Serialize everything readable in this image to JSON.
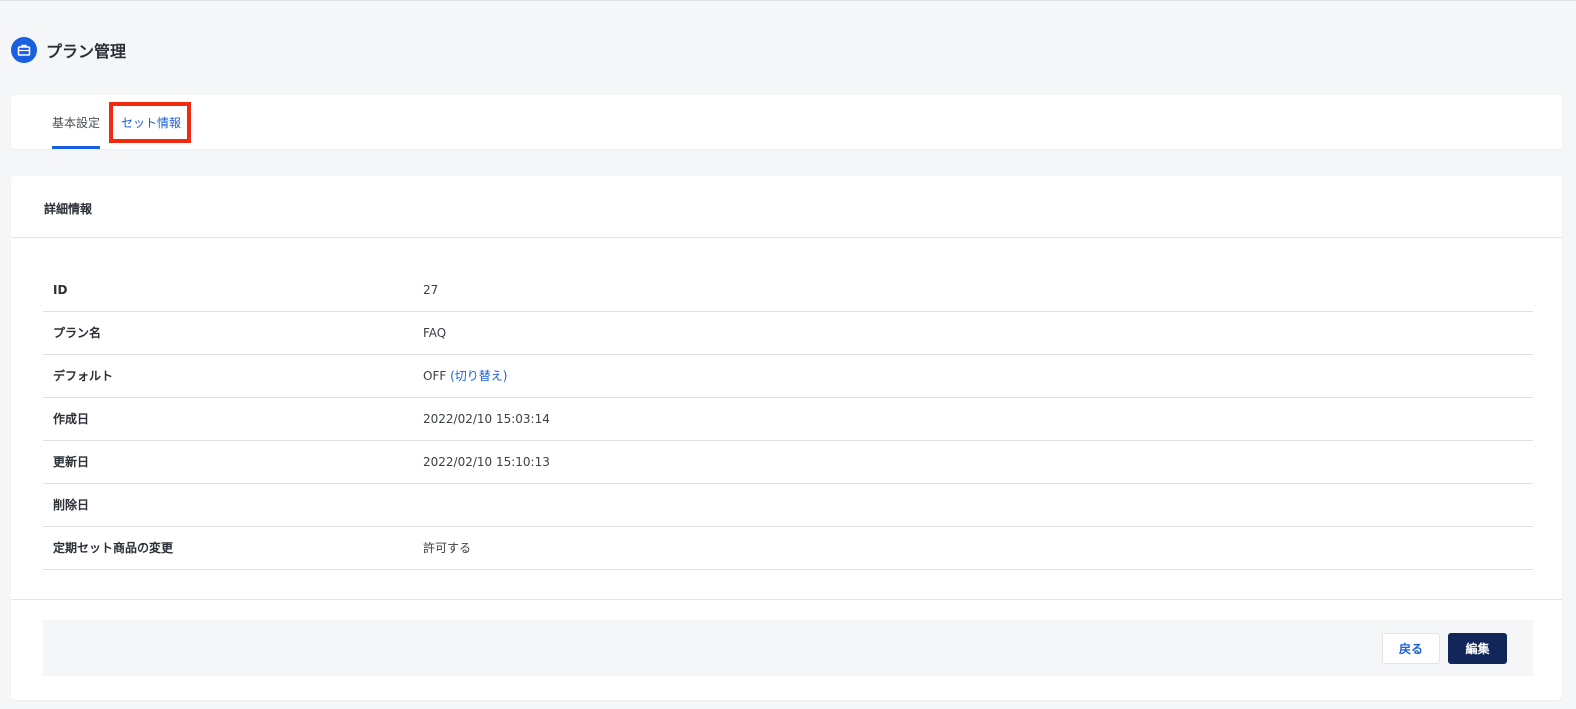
{
  "page": {
    "title": "プラン管理",
    "icon": "briefcase-icon",
    "accent_color": "#1a5fe0"
  },
  "tabs": [
    {
      "label": "基本設定",
      "active": true
    },
    {
      "label": "セット情報",
      "active": false
    }
  ],
  "detail": {
    "title": "詳細情報",
    "rows": [
      {
        "label": "ID",
        "value": "27"
      },
      {
        "label": "プラン名",
        "value": "FAQ"
      },
      {
        "label": "デフォルト",
        "value": "OFF",
        "link": "(切り替え)"
      },
      {
        "label": "作成日",
        "value": "2022/02/10 15:03:14"
      },
      {
        "label": "更新日",
        "value": "2022/02/10 15:10:13"
      },
      {
        "label": "削除日",
        "value": ""
      },
      {
        "label": "定期セット商品の変更",
        "value": "許可する"
      }
    ]
  },
  "footer": {
    "back_label": "戻る",
    "edit_label": "編集",
    "edit_color": "#12265a"
  }
}
